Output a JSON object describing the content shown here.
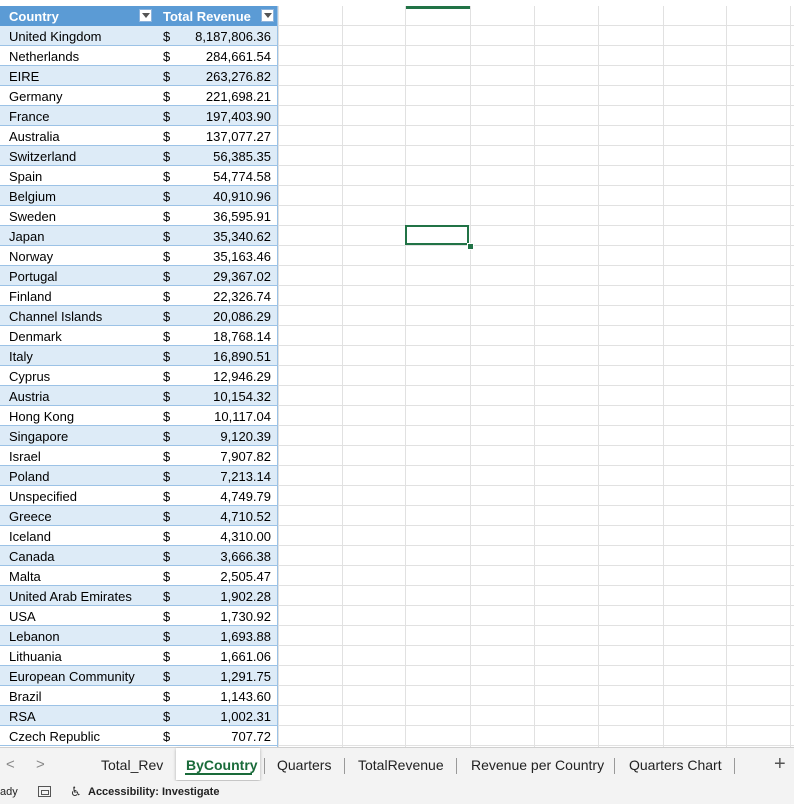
{
  "table": {
    "headers": {
      "country": "Country",
      "revenue": "Total Revenue"
    },
    "currency_symbol": "$",
    "rows": [
      {
        "country": "United Kingdom",
        "value": "8,187,806.36"
      },
      {
        "country": "Netherlands",
        "value": "284,661.54"
      },
      {
        "country": "EIRE",
        "value": "263,276.82"
      },
      {
        "country": "Germany",
        "value": "221,698.21"
      },
      {
        "country": "France",
        "value": "197,403.90"
      },
      {
        "country": "Australia",
        "value": "137,077.27"
      },
      {
        "country": "Switzerland",
        "value": "56,385.35"
      },
      {
        "country": "Spain",
        "value": "54,774.58"
      },
      {
        "country": "Belgium",
        "value": "40,910.96"
      },
      {
        "country": "Sweden",
        "value": "36,595.91"
      },
      {
        "country": "Japan",
        "value": "35,340.62"
      },
      {
        "country": "Norway",
        "value": "35,163.46"
      },
      {
        "country": "Portugal",
        "value": "29,367.02"
      },
      {
        "country": "Finland",
        "value": "22,326.74"
      },
      {
        "country": "Channel Islands",
        "value": "20,086.29"
      },
      {
        "country": "Denmark",
        "value": "18,768.14"
      },
      {
        "country": "Italy",
        "value": "16,890.51"
      },
      {
        "country": "Cyprus",
        "value": "12,946.29"
      },
      {
        "country": "Austria",
        "value": "10,154.32"
      },
      {
        "country": "Hong Kong",
        "value": "10,117.04"
      },
      {
        "country": "Singapore",
        "value": "9,120.39"
      },
      {
        "country": "Israel",
        "value": "7,907.82"
      },
      {
        "country": "Poland",
        "value": "7,213.14"
      },
      {
        "country": "Unspecified",
        "value": "4,749.79"
      },
      {
        "country": "Greece",
        "value": "4,710.52"
      },
      {
        "country": "Iceland",
        "value": "4,310.00"
      },
      {
        "country": "Canada",
        "value": "3,666.38"
      },
      {
        "country": "Malta",
        "value": "2,505.47"
      },
      {
        "country": "United Arab Emirates",
        "value": "1,902.28"
      },
      {
        "country": "USA",
        "value": "1,730.92"
      },
      {
        "country": "Lebanon",
        "value": "1,693.88"
      },
      {
        "country": "Lithuania",
        "value": "1,661.06"
      },
      {
        "country": "European Community",
        "value": "1,291.75"
      },
      {
        "country": "Brazil",
        "value": "1,143.60"
      },
      {
        "country": "RSA",
        "value": "1,002.31"
      },
      {
        "country": "Czech Republic",
        "value": "707.72"
      }
    ]
  },
  "tabs": [
    "Total_Rev",
    "ByCountry",
    "Quarters",
    "TotalRevenue",
    "Revenue per Country",
    "Quarters Chart"
  ],
  "active_tab": "ByCountry",
  "nav": {
    "prev": "<",
    "next": ">",
    "add": "+"
  },
  "status": {
    "ready": "ady",
    "accessibility": "Accessibility: Investigate"
  },
  "colors": {
    "header": "#5b9bd5",
    "band": "#ddebf7",
    "accent": "#217346"
  }
}
